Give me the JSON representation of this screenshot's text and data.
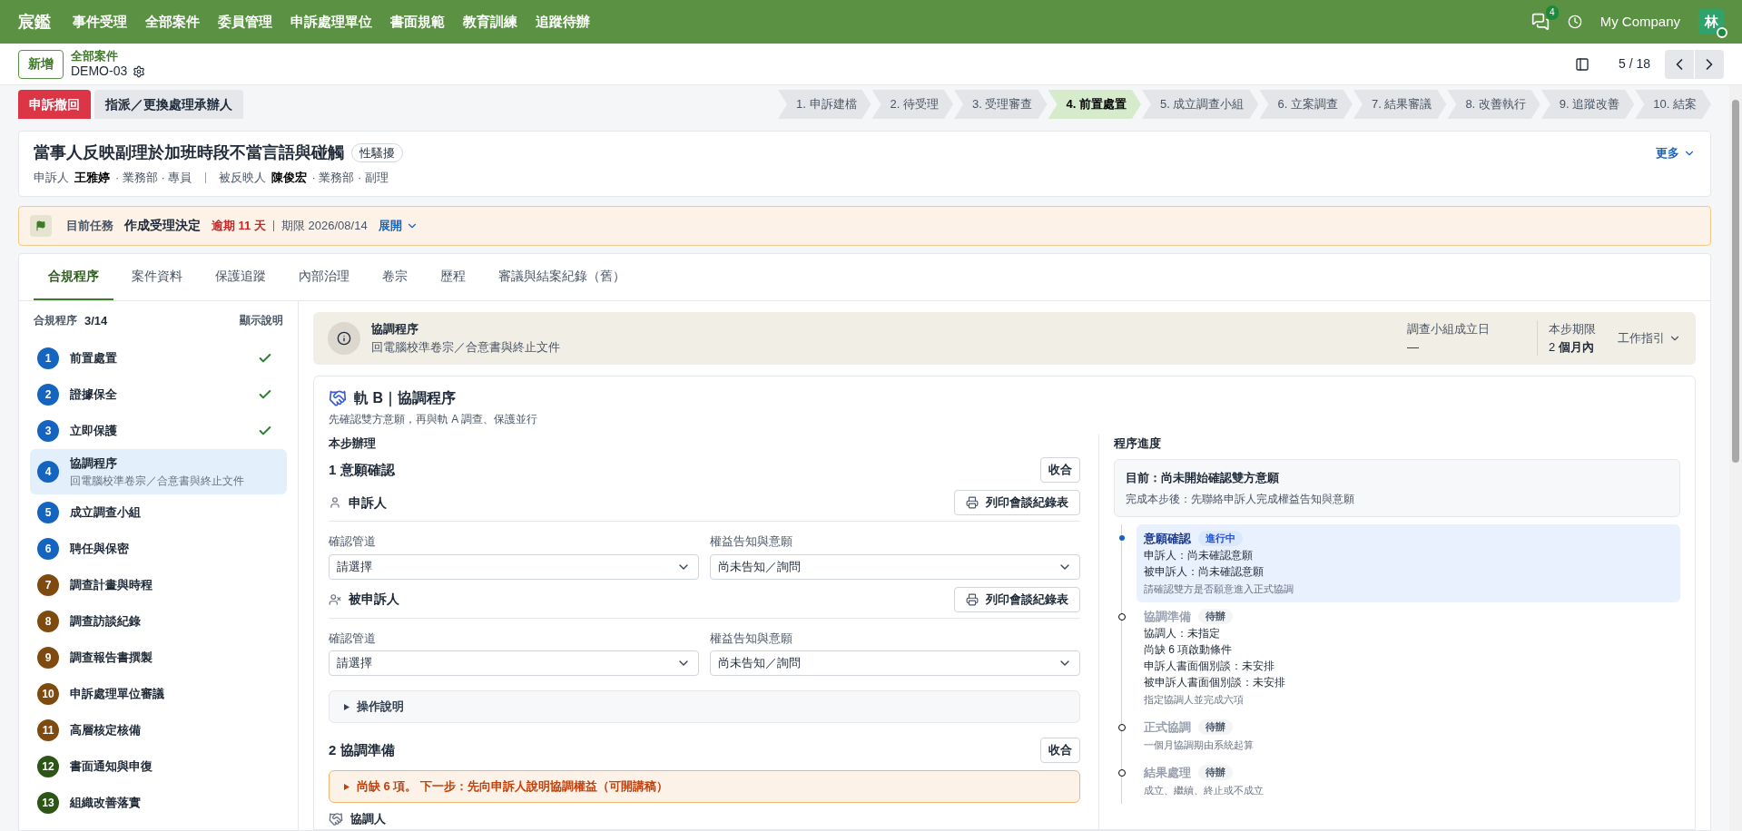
{
  "topbar": {
    "brand": "宸鑑",
    "menu": [
      "事件受理",
      "全部案件",
      "委員管理",
      "申訴處理單位",
      "書面規範",
      "教育訓練",
      "追蹤待辦"
    ],
    "notification_count": "4",
    "company": "My Company",
    "avatar": "林"
  },
  "breadcrumb": {
    "new_button": "新增",
    "parent": "全部案件",
    "current": "DEMO-03",
    "pager": "5 / 18"
  },
  "actions": [
    {
      "label": "申訴撤回",
      "kind": "danger"
    },
    {
      "label": "指派／更換處理承辦人",
      "kind": "secondary"
    }
  ],
  "stages": [
    {
      "label": "1. 申訴建檔",
      "selected": false
    },
    {
      "label": "2. 待受理",
      "selected": false
    },
    {
      "label": "3. 受理審查",
      "selected": false
    },
    {
      "label": "4. 前置處置",
      "selected": true
    },
    {
      "label": "5. 成立調查小組",
      "selected": false
    },
    {
      "label": "6. 立案調查",
      "selected": false
    },
    {
      "label": "7. 結果審議",
      "selected": false
    },
    {
      "label": "8. 改善執行",
      "selected": false
    },
    {
      "label": "9. 追蹤改善",
      "selected": false
    },
    {
      "label": "10. 結案",
      "selected": false
    }
  ],
  "case": {
    "title": "當事人反映副理於加班時段不當言語與碰觸",
    "tag": "性騷擾",
    "complainant_label": "申訴人",
    "complainant": "王雅婷",
    "complainant_info": "· 業務部 · 專員",
    "respondent_label": "被反映人",
    "respondent": "陳俊宏",
    "respondent_info": "· 業務部 · 副理",
    "more": "更多"
  },
  "task": {
    "label": "目前任務",
    "name": "作成受理決定",
    "overdue": "逾期 11 天",
    "deadline": "期限 2026/08/14",
    "expand": "展開"
  },
  "tabs": [
    {
      "label": "合規程序",
      "selected": true
    },
    {
      "label": "案件資料",
      "selected": false
    },
    {
      "label": "保護追蹤",
      "selected": false
    },
    {
      "label": "內部治理",
      "selected": false
    },
    {
      "label": "卷宗",
      "selected": false
    },
    {
      "label": "歷程",
      "selected": false
    },
    {
      "label": "審議與結案紀錄（舊）",
      "selected": false
    }
  ],
  "steps_panel": {
    "title": "合規程序",
    "count": "3/14",
    "help": "顯示說明",
    "steps": [
      {
        "number": "1",
        "label": "前置處置",
        "color": "#1565c0",
        "done": true,
        "selected": false
      },
      {
        "number": "2",
        "label": "證據保全",
        "color": "#1565c0",
        "done": true,
        "selected": false
      },
      {
        "number": "3",
        "label": "立即保護",
        "color": "#1565c0",
        "done": true,
        "selected": false
      },
      {
        "number": "4",
        "label": "協調程序",
        "subtitle": "回電腦校準卷宗／合意書與終止文件",
        "color": "#1565c0",
        "done": false,
        "selected": true
      },
      {
        "number": "5",
        "label": "成立調查小組",
        "color": "#1565c0",
        "done": false,
        "selected": false
      },
      {
        "number": "6",
        "label": "聘任與保密",
        "color": "#1565c0",
        "done": false,
        "selected": false
      },
      {
        "number": "7",
        "label": "調查計畫與時程",
        "color": "#7f4a0e",
        "done": false,
        "selected": false
      },
      {
        "number": "8",
        "label": "調查訪談紀錄",
        "color": "#7f4a0e",
        "done": false,
        "selected": false
      },
      {
        "number": "9",
        "label": "調查報告書撰製",
        "color": "#7f4a0e",
        "done": false,
        "selected": false
      },
      {
        "number": "10",
        "label": "申訴處理單位審議",
        "color": "#7f4a0e",
        "done": false,
        "selected": false
      },
      {
        "number": "11",
        "label": "高層核定核備",
        "color": "#7f4a0e",
        "done": false,
        "selected": false
      },
      {
        "number": "12",
        "label": "書面通知與申復",
        "color": "#2c5516",
        "done": false,
        "selected": false
      },
      {
        "number": "13",
        "label": "組織改善落實",
        "color": "#2c5516",
        "done": false,
        "selected": false
      }
    ]
  },
  "banner": {
    "title": "協調程序",
    "subtitle": "回電腦校準卷宗／合意書與終止文件",
    "fields": [
      {
        "label": "調查小組成立日",
        "value": "—"
      },
      {
        "label": "本步期限",
        "value": "2 **個月內**"
      }
    ],
    "guide": "工作指引"
  },
  "track": {
    "title": "軌 B｜協調程序",
    "subtitle": "先確認雙方意願，再與軌 A 調查、保護並行",
    "handle_label": "本步辦理",
    "section_1": {
      "title": "1 意願確認",
      "collapse": "收合",
      "help": "操作說明",
      "parties": [
        {
          "name": "申訴人",
          "kind": "complainant",
          "print": "列印會談紀錄表",
          "fields": [
            {
              "label": "確認管道",
              "value": "請選擇"
            },
            {
              "label": "權益告知與意願",
              "value": "尚未告知／詢問"
            }
          ]
        },
        {
          "name": "被申訴人",
          "kind": "respondent",
          "print": "列印會談紀錄表",
          "fields": [
            {
              "label": "確認管道",
              "value": "請選擇"
            },
            {
              "label": "權益告知與意願",
              "value": "尚未告知／詢問"
            }
          ]
        }
      ]
    },
    "section_2": {
      "title": "2 協調準備",
      "collapse": "收合",
      "warning": "尚缺 6 項。 下一步：先向申訴人說明協調權益（可開講稿）",
      "mediator": "協調人"
    }
  },
  "progress": {
    "title": "程序進度",
    "current": "目前：尚未開始確認雙方意願",
    "after": "完成本步後：先聯絡申訴人完成權益告知與意願",
    "timeline": [
      {
        "title": "意願確認",
        "status": "進行中",
        "selected": true,
        "lines": [
          "申訴人：尚未確認意願",
          "被申訴人：尚未確認意願"
        ],
        "note": "請確認雙方是否願意進入正式協調"
      },
      {
        "title": "協調準備",
        "status": "待辦",
        "selected": false,
        "lines": [
          "協調人：未指定",
          "尚缺 6 項啟動條件",
          "申訴人書面個別談：未安排",
          "被申訴人書面個別談：未安排"
        ],
        "note": "指定協調人並完成六項"
      },
      {
        "title": "正式協調",
        "status": "待辦",
        "selected": false,
        "note": "一個月協調期由系統起算"
      },
      {
        "title": "結果處理",
        "status": "待辦",
        "selected": false,
        "note": "成立、繼續、終止或不成立"
      }
    ]
  }
}
